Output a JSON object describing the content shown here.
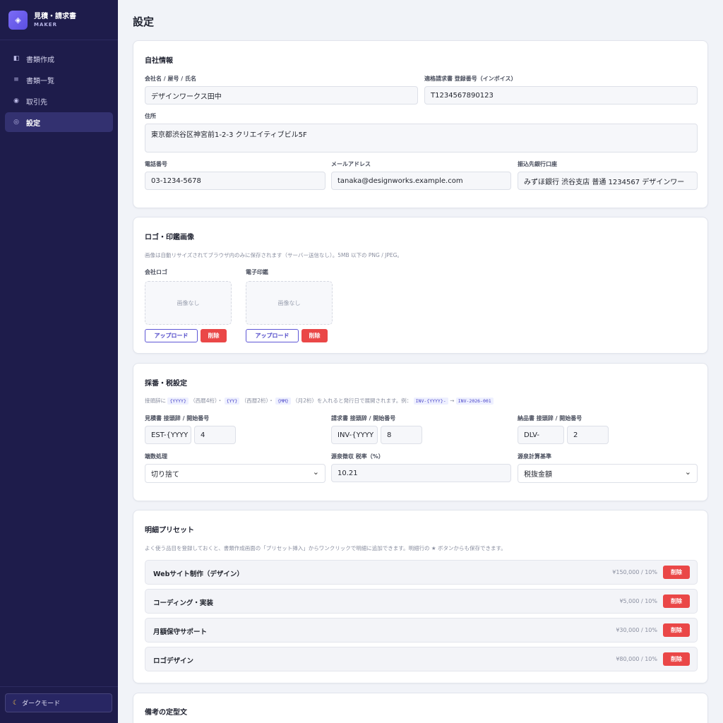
{
  "sidebar": {
    "brand_title": "見積・請求書",
    "brand_sub": "MAKER",
    "items": [
      {
        "label": "書類作成",
        "icon": "document-icon"
      },
      {
        "label": "書類一覧",
        "icon": "list-icon"
      },
      {
        "label": "取引先",
        "icon": "circle-icon"
      },
      {
        "label": "設定",
        "icon": "settings-icon"
      }
    ],
    "active_item": "設定",
    "dark_mode_label": "ダークモード"
  },
  "page_title": "設定",
  "company": {
    "title": "自社情報",
    "name_label": "会社名 / 屋号 / 氏名",
    "name_value": "デザインワークス田中",
    "invoice_label": "適格請求書 登録番号（インボイス）",
    "invoice_value": "T1234567890123",
    "address_label": "住所",
    "address_value": "東京都渋谷区神宮前1-2-3 クリエイティブビル5F",
    "phone_label": "電話番号",
    "phone_value": "03-1234-5678",
    "email_label": "メールアドレス",
    "email_value": "tanaka@designworks.example.com",
    "bank_label": "振込先銀行口座",
    "bank_value": "みずほ銀行 渋谷支店 普通 1234567 デザインワー"
  },
  "logo": {
    "title": "ロゴ・印鑑画像",
    "hint": "画像は自動リサイズされてブラウザ内のみに保存されます（サーバー送信なし）。5MB 以下の PNG / JPEG。",
    "logo_label": "会社ロゴ",
    "seal_label": "電子印鑑",
    "no_image": "画像なし",
    "upload_label": "アップロード",
    "delete_label": "削除"
  },
  "numbering": {
    "title": "採番・税設定",
    "hint_1": "接頭辞に",
    "code_1": "{YYYY}",
    "hint_2": "（西暦4桁）・",
    "code_2": "{YY}",
    "hint_3": "（西暦2桁）・",
    "code_3": "{MM}",
    "hint_4": "（月2桁）を入れると発行日で展開されます。例：",
    "code_4": "INV-{YYYY}-",
    "arrow": "→",
    "code_5": "INV-2026-001",
    "estimate_label": "見積書 接頭辞 / 開始番号",
    "estimate_prefix": "EST-{YYYY",
    "estimate_start": "4",
    "invoice_label": "請求書 接頭辞 / 開始番号",
    "invoice_prefix": "INV-{YYYY",
    "invoice_start": "8",
    "delivery_label": "納品書 接頭辞 / 開始番号",
    "delivery_prefix": "DLV-",
    "delivery_start": "2",
    "rounding_label": "端数処理",
    "rounding_value": "切り捨て",
    "withholding_label": "源泉徴収 税率（%）",
    "withholding_value": "10.21",
    "basis_label": "源泉計算基準",
    "basis_value": "税抜金額"
  },
  "presets": {
    "title": "明細プリセット",
    "hint": "よく使う品目を登録しておくと、書類作成画面の「プリセット挿入」からワンクリックで明細に追加できます。明細行の ★ ボタンからも保存できます。",
    "delete_label": "削除",
    "items": [
      {
        "name": "Webサイト制作（デザイン）",
        "price": "¥150,000 / 10%"
      },
      {
        "name": "コーディング・実装",
        "price": "¥5,000 / 10%"
      },
      {
        "name": "月額保守サポート",
        "price": "¥30,000 / 10%"
      },
      {
        "name": "ロゴデザイン",
        "price": "¥80,000 / 10%"
      }
    ]
  },
  "notes": {
    "title": "備考の定型文"
  }
}
